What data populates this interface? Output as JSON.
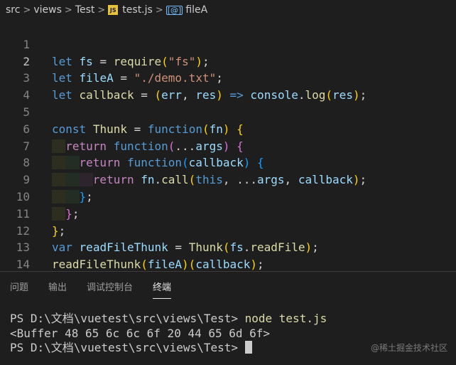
{
  "breadcrumb": {
    "items": [
      "src",
      "views",
      "Test"
    ],
    "file": "test.js",
    "file_badge": "JS",
    "symbol": "fileA",
    "symbol_icon": "variable-icon",
    "separator": ">"
  },
  "editor": {
    "active_line": 2,
    "lines": [
      {
        "num": "1",
        "text": "let fs = require(\"fs\");"
      },
      {
        "num": "2",
        "text": "let fileA = \"./demo.txt\";"
      },
      {
        "num": "3",
        "text": "let callback = (err, res) => console.log(res);"
      },
      {
        "num": "4",
        "text": ""
      },
      {
        "num": "5",
        "text": "const Thunk = function(fn) {"
      },
      {
        "num": "6",
        "text": "return function(...args) {"
      },
      {
        "num": "7",
        "text": "return function(callback) {"
      },
      {
        "num": "8",
        "text": "return fn.call(this, ...args, callback);"
      },
      {
        "num": "9",
        "text": "};"
      },
      {
        "num": "10",
        "text": "};"
      },
      {
        "num": "11",
        "text": "};"
      },
      {
        "num": "12",
        "text": "var readFileThunk = Thunk(fs.readFile);"
      },
      {
        "num": "13",
        "text": "readFileThunk(fileA)(callback);"
      },
      {
        "num": "14",
        "text": ""
      }
    ]
  },
  "panel": {
    "tabs": [
      "问题",
      "输出",
      "调试控制台",
      "终端"
    ],
    "active_tab": "终端"
  },
  "terminal": {
    "line1_prompt": "PS D:\\文档\\vuetest\\src\\views\\Test> ",
    "line1_cmd": "node test.js",
    "line2": "<Buffer 48 65 6c 6c 6f 20 44 65 6d 6f>",
    "line3_prompt": "PS D:\\文档\\vuetest\\src\\views\\Test> "
  },
  "watermark": "@稀土掘金技术社区",
  "colors": {
    "background": "#1e1e1e",
    "keyword": "#569cd6",
    "variable": "#9cdcfe",
    "function": "#dcdcaa",
    "string": "#ce9178",
    "class": "#4ec9b0",
    "control": "#c586c0"
  }
}
